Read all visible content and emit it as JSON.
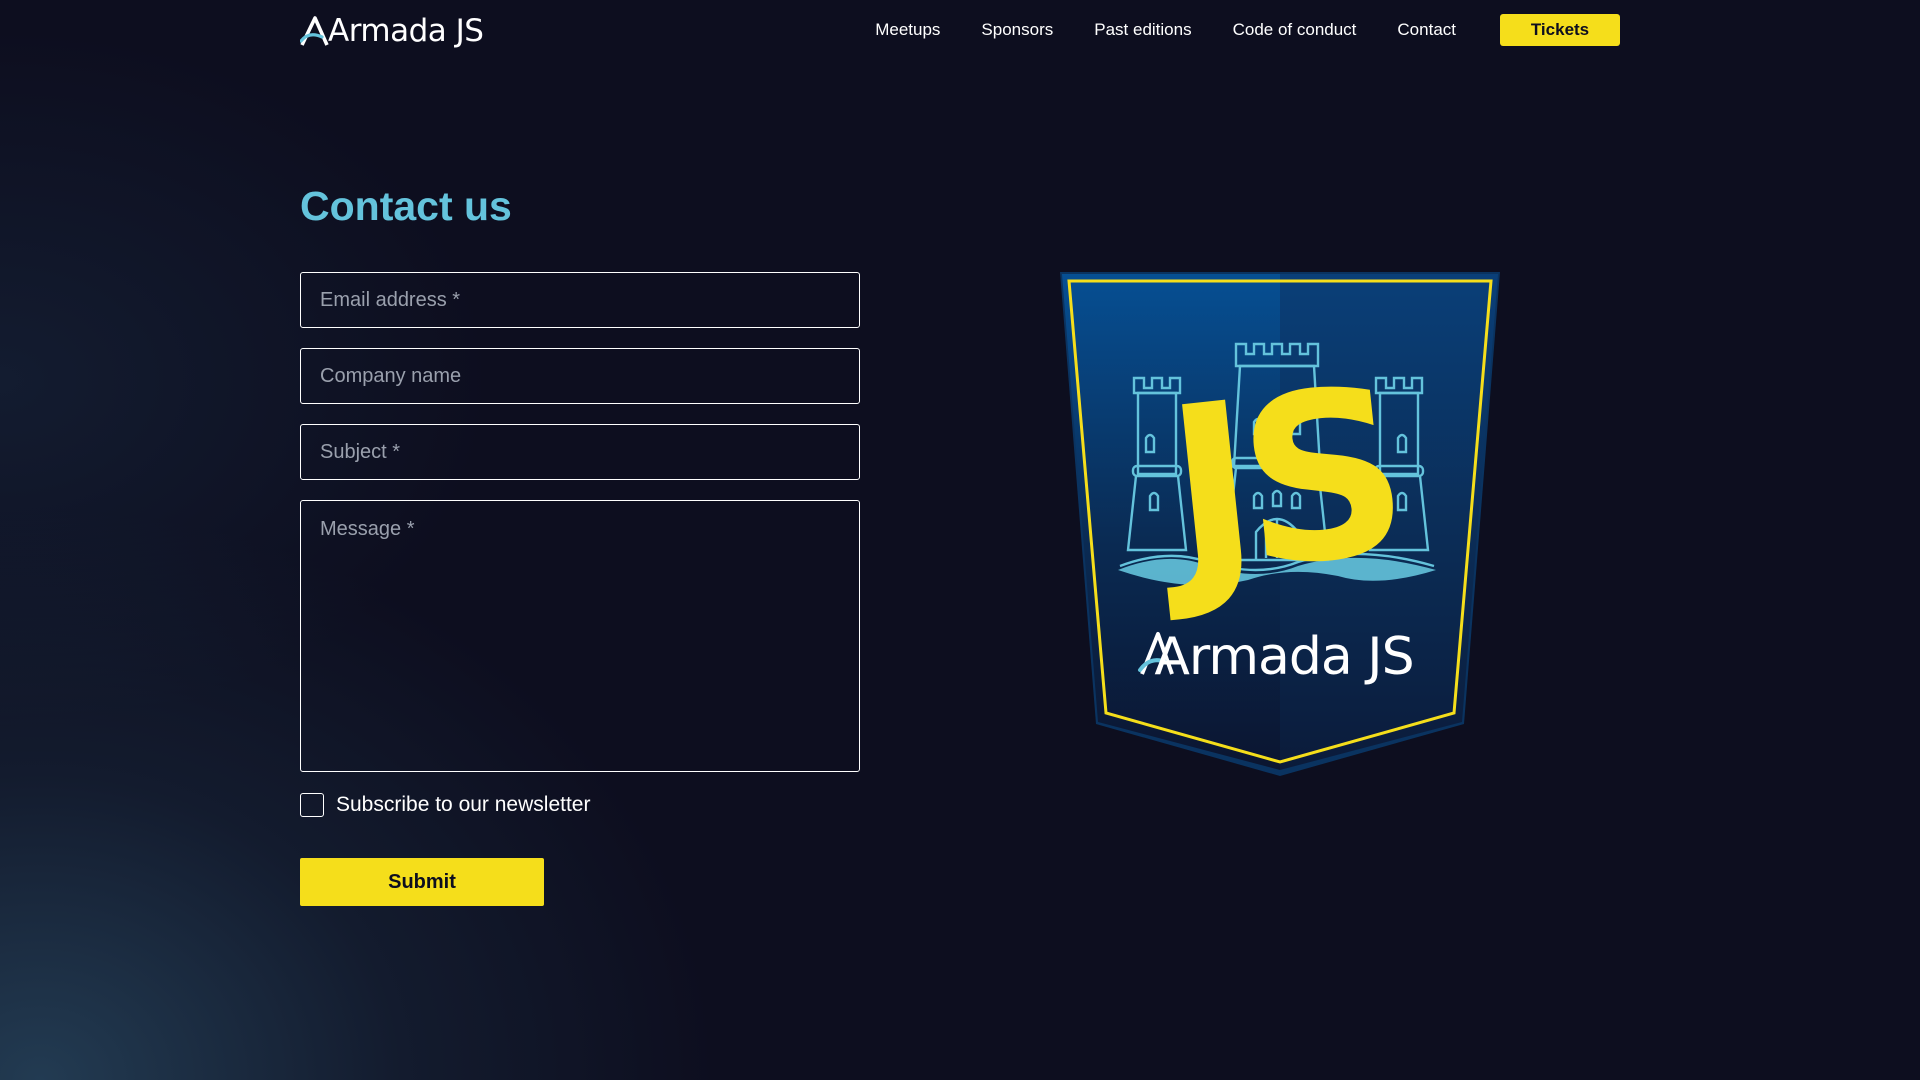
{
  "header": {
    "logo_text": "Armada JS",
    "nav": [
      "Meetups",
      "Sponsors",
      "Past editions",
      "Code of conduct",
      "Contact"
    ],
    "tickets_label": "Tickets"
  },
  "main": {
    "title": "Contact us",
    "form": {
      "email_placeholder": "Email address *",
      "company_placeholder": "Company name",
      "subject_placeholder": "Subject *",
      "message_placeholder": "Message *",
      "newsletter_label": "Subscribe to our newsletter",
      "newsletter_checked": false,
      "submit_label": "Submit"
    },
    "badge": {
      "wordmark": "Armada JS",
      "letters": "JS"
    }
  },
  "colors": {
    "background": "#0d0e1f",
    "accent_yellow": "#f5de1b",
    "title_blue": "#64c3dc",
    "shield_blue": "#0b4b86"
  }
}
